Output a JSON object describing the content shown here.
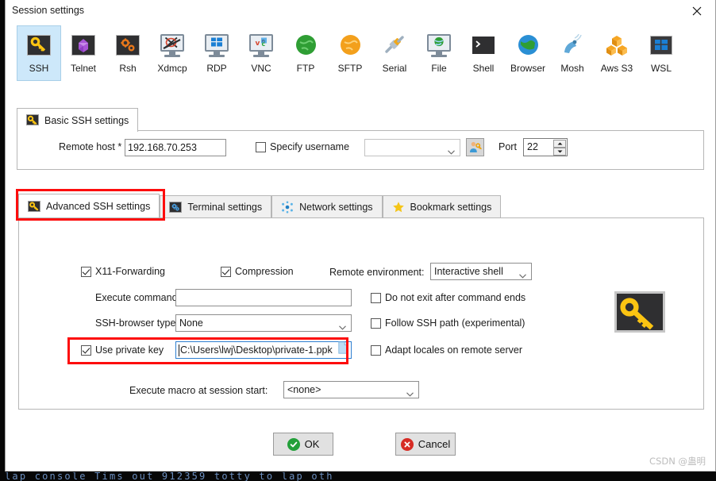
{
  "window": {
    "title": "Session settings",
    "close_label": "close-button"
  },
  "session_types": [
    {
      "label": "SSH",
      "icon": "ssh-key-icon",
      "selected": true
    },
    {
      "label": "Telnet",
      "icon": "telnet-icon",
      "selected": false
    },
    {
      "label": "Rsh",
      "icon": "rsh-gears-icon",
      "selected": false
    },
    {
      "label": "Xdmcp",
      "icon": "xdmcp-icon",
      "selected": false
    },
    {
      "label": "RDP",
      "icon": "rdp-windows-icon",
      "selected": false
    },
    {
      "label": "VNC",
      "icon": "vnc-icon",
      "selected": false
    },
    {
      "label": "FTP",
      "icon": "ftp-globe-icon",
      "selected": false
    },
    {
      "label": "SFTP",
      "icon": "sftp-globe-icon",
      "selected": false
    },
    {
      "label": "Serial",
      "icon": "serial-plug-icon",
      "selected": false
    },
    {
      "label": "File",
      "icon": "file-monitor-icon",
      "selected": false
    },
    {
      "label": "Shell",
      "icon": "shell-prompt-icon",
      "selected": false
    },
    {
      "label": "Browser",
      "icon": "browser-globe-icon",
      "selected": false
    },
    {
      "label": "Mosh",
      "icon": "mosh-dish-icon",
      "selected": false
    },
    {
      "label": "Aws S3",
      "icon": "aws-s3-cubes-icon",
      "selected": false
    },
    {
      "label": "WSL",
      "icon": "wsl-windows-icon",
      "selected": false
    }
  ],
  "basic_panel": {
    "tab_label": "Basic SSH settings",
    "tab_icon": "key-icon",
    "remote_host_label": "Remote host *",
    "remote_host_value": "192.168.70.253",
    "specify_username_label": "Specify username",
    "specify_username_checked": false,
    "username_value": "",
    "username_placeholder": "",
    "user_key_button": "user-key-button",
    "port_label": "Port",
    "port_value": "22"
  },
  "settings_tabs": [
    {
      "label": "Advanced SSH settings",
      "icon": "key-icon",
      "active": true
    },
    {
      "label": "Terminal settings",
      "icon": "terminal-icon",
      "active": false
    },
    {
      "label": "Network settings",
      "icon": "network-icon",
      "active": false
    },
    {
      "label": "Bookmark settings",
      "icon": "star-icon",
      "active": false
    }
  ],
  "advanced": {
    "x11_label": "X11-Forwarding",
    "x11_checked": true,
    "compression_label": "Compression",
    "compression_checked": true,
    "remote_env_label": "Remote environment:",
    "remote_env_value": "Interactive shell",
    "execute_command_label": "Execute command:",
    "execute_command_value": "",
    "do_not_exit_label": "Do not exit after command ends",
    "do_not_exit_checked": false,
    "ssh_browser_label": "SSH-browser type:",
    "ssh_browser_value": "None",
    "follow_ssh_path_label": "Follow SSH path (experimental)",
    "follow_ssh_path_checked": false,
    "use_private_key_label": "Use private key",
    "use_private_key_checked": true,
    "private_key_path": "C:\\Users\\lwj\\Desktop\\private-1.ppk",
    "browse_icon": "file-browse-icon",
    "adapt_locales_label": "Adapt locales on remote server",
    "adapt_locales_checked": false,
    "macro_label": "Execute macro at session start:",
    "macro_value": "<none>",
    "panel_icon": "large-key-icon"
  },
  "buttons": {
    "ok_label": "OK",
    "ok_icon": "check-circle-icon",
    "cancel_label": "Cancel",
    "cancel_icon": "x-circle-icon"
  },
  "annotations": [
    {
      "name": "advanced-ssh-settings-highlight"
    },
    {
      "name": "use-private-key-highlight"
    }
  ],
  "watermark": "CSDN @蛊明",
  "terminal_behind": "lap console Tims out 912359 totty to lap oth",
  "colors": {
    "accent_selected": "#cde8fa",
    "annotation_red": "#fd0d0d",
    "key_yellow": "#fbc412",
    "ok_green": "#23a03a",
    "cancel_red": "#d62b24",
    "focus_blue": "#2f7fd0"
  }
}
